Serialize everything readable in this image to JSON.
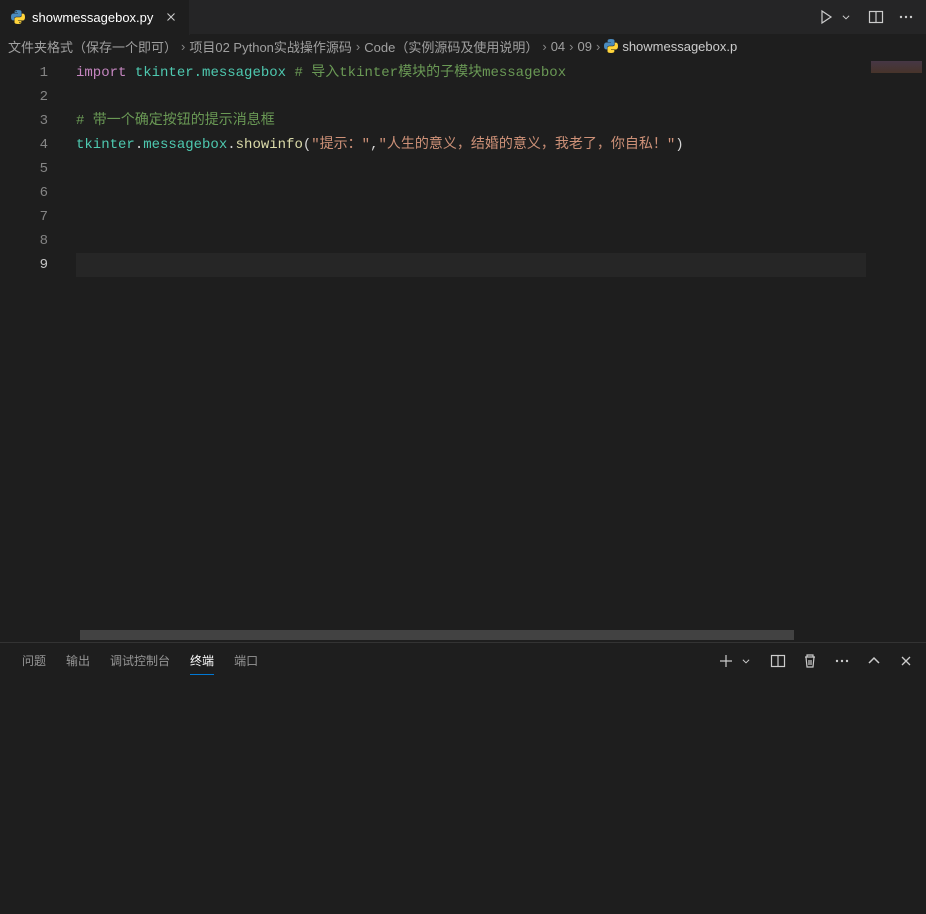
{
  "tab": {
    "filename": "showmessagebox.py",
    "icon": "python-file-icon"
  },
  "tabActions": {
    "run": "run-icon",
    "runDropdown": "chevron-down-icon",
    "split": "split-editor-icon",
    "more": "more-icon"
  },
  "breadcrumb": {
    "items": [
      "文件夹格式（保存一个即可）",
      "项目02 Python实战操作源码",
      "Code（实例源码及使用说明）",
      "04",
      "09"
    ],
    "file": "showmessagebox.p"
  },
  "code": {
    "lines": [
      {
        "n": 1,
        "tokens": [
          {
            "t": "import",
            "c": "kw"
          },
          {
            "t": " ",
            "c": ""
          },
          {
            "t": "tkinter.messagebox",
            "c": "mod"
          },
          {
            "t": " ",
            "c": ""
          },
          {
            "t": "# 导入tkinter模块的子模块messagebox",
            "c": "comment"
          }
        ]
      },
      {
        "n": 2,
        "tokens": []
      },
      {
        "n": 3,
        "tokens": [
          {
            "t": "# 带一个确定按钮的提示消息框",
            "c": "comment"
          }
        ]
      },
      {
        "n": 4,
        "tokens": [
          {
            "t": "tkinter",
            "c": "mod"
          },
          {
            "t": ".",
            "c": "punct"
          },
          {
            "t": "messagebox",
            "c": "mod"
          },
          {
            "t": ".",
            "c": "punct"
          },
          {
            "t": "showinfo",
            "c": "func"
          },
          {
            "t": "(",
            "c": "punct"
          },
          {
            "t": "\"提示：\"",
            "c": "str"
          },
          {
            "t": ",",
            "c": "punct"
          },
          {
            "t": "\"人生的意义，结婚的意义，我老了，你自私！\"",
            "c": "str"
          },
          {
            "t": ")",
            "c": "punct"
          }
        ]
      },
      {
        "n": 5,
        "tokens": []
      },
      {
        "n": 6,
        "tokens": []
      },
      {
        "n": 7,
        "tokens": []
      },
      {
        "n": 8,
        "tokens": []
      },
      {
        "n": 9,
        "tokens": [],
        "active": true
      }
    ]
  },
  "panel": {
    "tabs": [
      {
        "label": "问题",
        "id": "problems"
      },
      {
        "label": "输出",
        "id": "output"
      },
      {
        "label": "调试控制台",
        "id": "debug-console"
      },
      {
        "label": "终端",
        "id": "terminal",
        "active": true
      },
      {
        "label": "端口",
        "id": "ports"
      }
    ],
    "actions": {
      "new": "plus-icon",
      "newDropdown": "chevron-down-icon",
      "split": "split-panel-icon",
      "kill": "trash-icon",
      "more": "more-icon",
      "maximize": "chevron-up-icon",
      "close": "close-icon"
    }
  }
}
